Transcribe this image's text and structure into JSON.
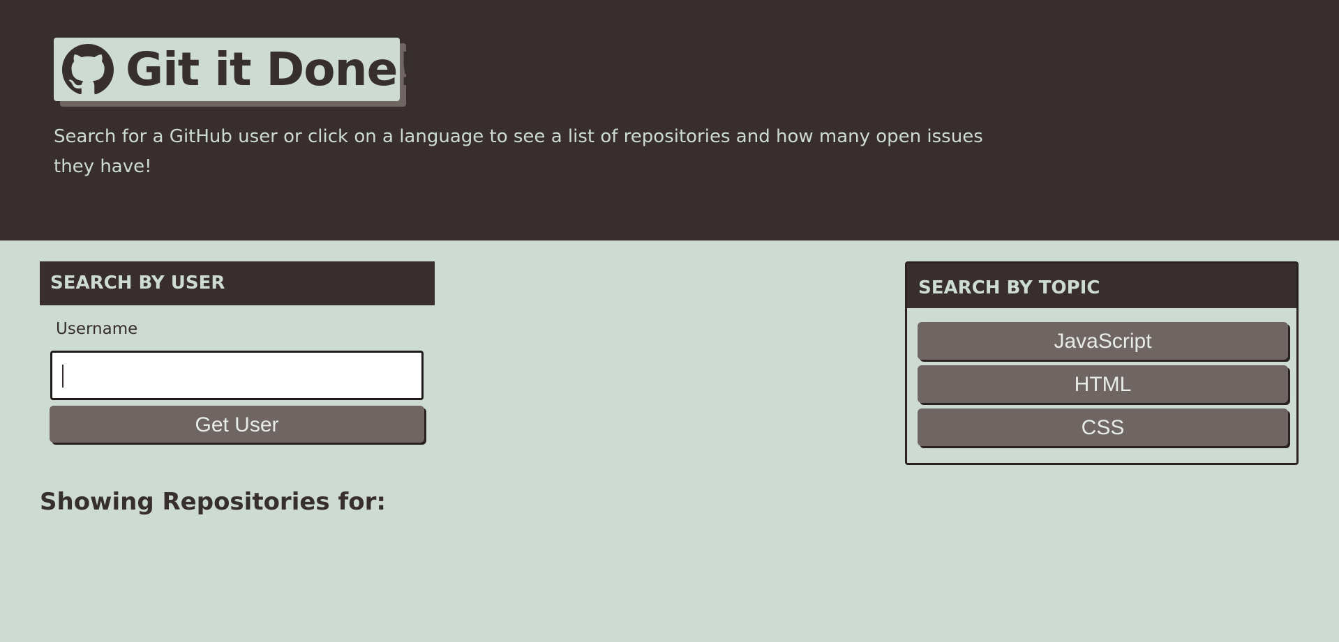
{
  "header": {
    "title": "Git it Done!",
    "logo_icon": "github-octocat-icon",
    "subtitle": "Search for a GitHub user or click on a language to see a list of repositories and how many open issues they have!"
  },
  "user_search": {
    "heading": "SEARCH BY USER",
    "username_label": "Username",
    "username_value": "",
    "submit_label": "Get User"
  },
  "topic_search": {
    "heading": "SEARCH BY TOPIC",
    "languages": [
      "JavaScript",
      "HTML",
      "CSS"
    ]
  },
  "results": {
    "heading": "Showing Repositories for:"
  },
  "colors": {
    "dark": "#382e2e",
    "light": "#cddbd2",
    "button": "#6f6563"
  }
}
